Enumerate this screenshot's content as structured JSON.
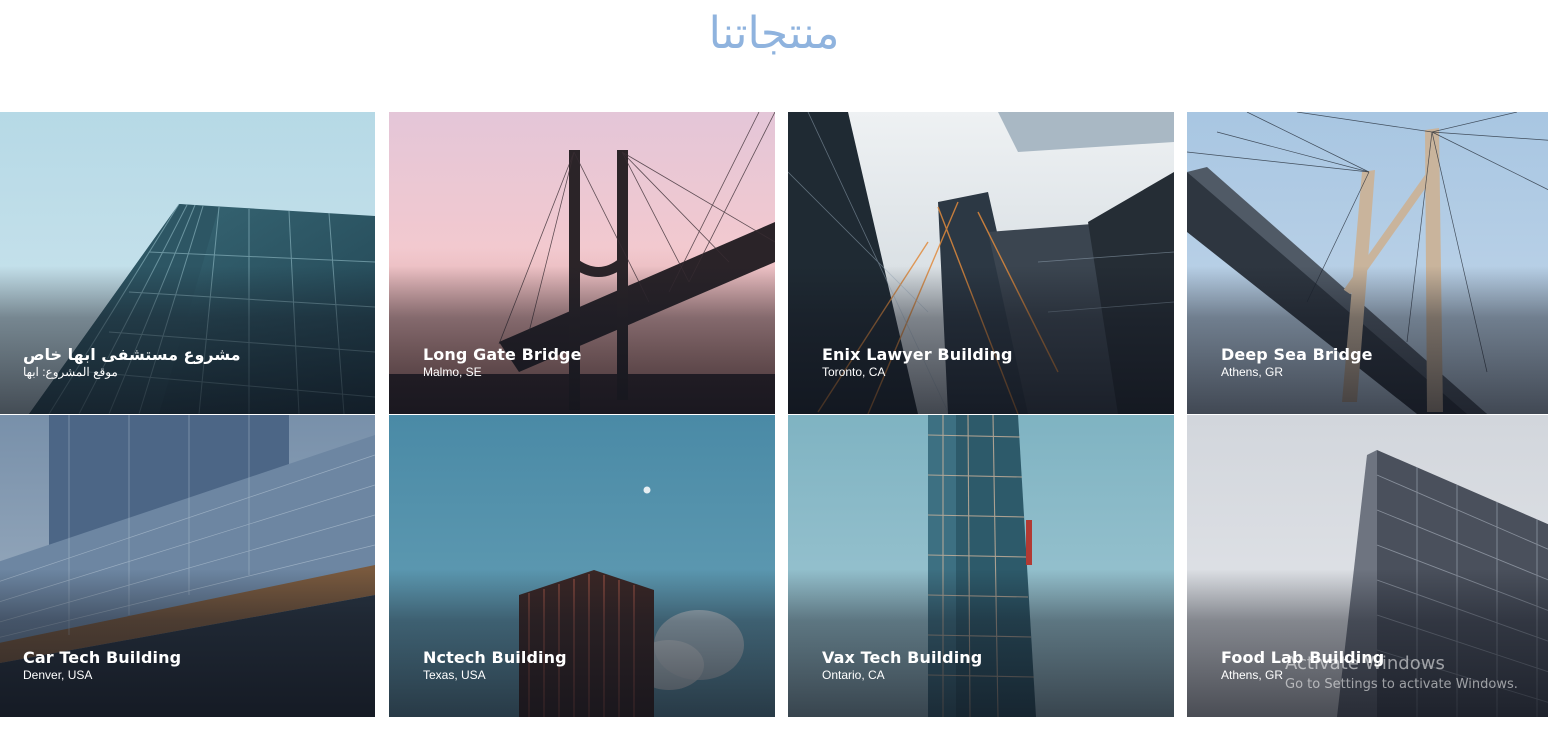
{
  "page": {
    "title": "منتجاتنا"
  },
  "projects": [
    {
      "name": "مشروع مستشفى ابها خاص",
      "location": "موقع المشروع: ابها"
    },
    {
      "name": "Long Gate Bridge",
      "location": "Malmo, SE"
    },
    {
      "name": "Enix Lawyer Building",
      "location": "Toronto, CA"
    },
    {
      "name": "Deep Sea Bridge",
      "location": "Athens, GR"
    },
    {
      "name": "Car Tech Building",
      "location": "Denver, USA"
    },
    {
      "name": "Nctech Building",
      "location": "Texas, USA"
    },
    {
      "name": "Vax Tech Building",
      "location": "Ontario, CA"
    },
    {
      "name": "Food Lab Building",
      "location": "Athens, GR"
    }
  ],
  "watermark": {
    "line1": "Activate Windows",
    "line2": "Go to Settings to activate Windows."
  },
  "colors": {
    "title": "#8fb3de",
    "caption": "#ffffff"
  }
}
